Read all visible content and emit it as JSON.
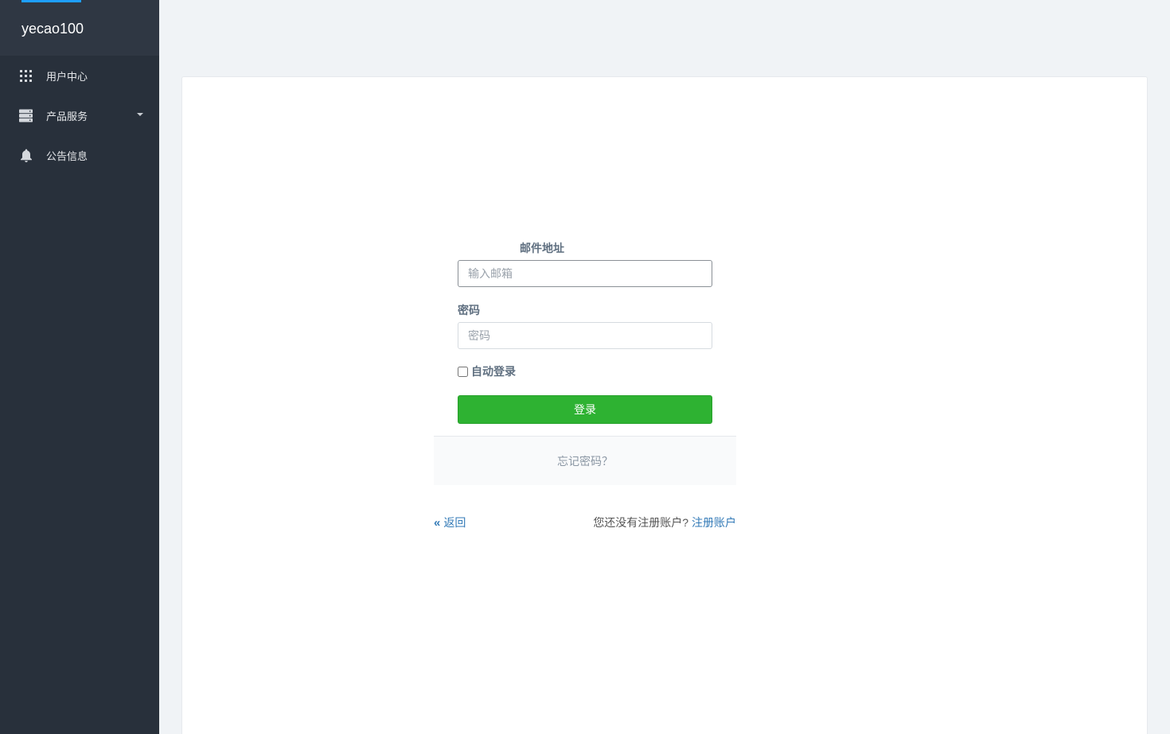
{
  "sidebar": {
    "brand": "yecao100",
    "accent_color": "#1e9fff",
    "items": [
      {
        "label": "用户中心",
        "icon": "grid-icon"
      },
      {
        "label": "产品服务",
        "icon": "server-icon",
        "has_submenu": true
      },
      {
        "label": "公告信息",
        "icon": "bell-icon"
      }
    ]
  },
  "login": {
    "email_label": "邮件地址",
    "email_placeholder": "输入邮箱",
    "password_label": "密码",
    "password_placeholder": "密码",
    "remember_label": "自动登录",
    "remember_checked": false,
    "submit_label": "登录",
    "submit_color": "#2eb232",
    "forgot_label": "忘记密码？",
    "back_label": "返回",
    "no_account_text": "您还没有注册账户?",
    "register_label": "注册账户"
  }
}
